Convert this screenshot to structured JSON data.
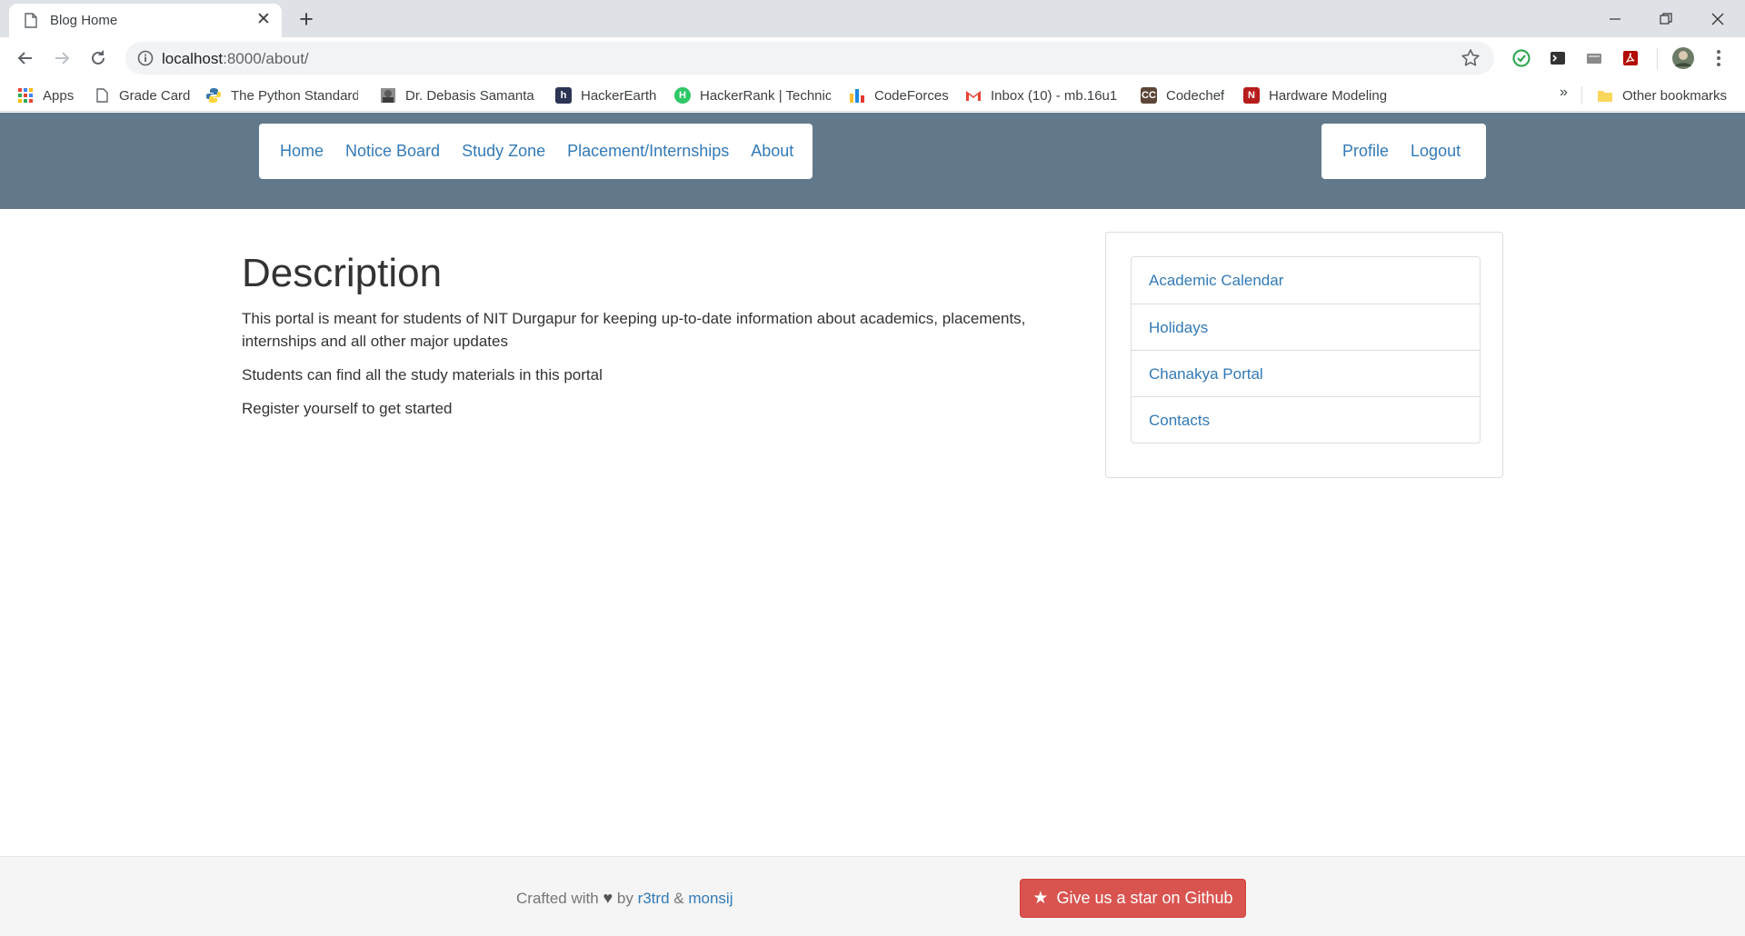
{
  "browser": {
    "tab_title": "Blog Home",
    "new_tab_symbol": "+",
    "close_symbol": "✕",
    "url_host": "localhost",
    "url_rest": ":8000/about/"
  },
  "bookmarks": {
    "apps": "Apps",
    "items": [
      {
        "label": "Grade Card",
        "icon": "page-icon"
      },
      {
        "label": "The Python Standard",
        "icon": "python-icon"
      },
      {
        "label": "Dr. Debasis Samanta,",
        "icon": "portrait-icon"
      },
      {
        "label": "HackerEarth",
        "icon": "hackerearth-icon"
      },
      {
        "label": "HackerRank | Technic",
        "icon": "hackerrank-icon"
      },
      {
        "label": "CodeForces",
        "icon": "codeforces-icon"
      },
      {
        "label": "Inbox (10) - mb.16u1",
        "icon": "gmail-icon"
      },
      {
        "label": "Codechef",
        "icon": "codechef-icon"
      },
      {
        "label": "Hardware Modeling",
        "icon": "nptel-icon"
      }
    ],
    "more": "»",
    "other": "Other bookmarks"
  },
  "site": {
    "nav_left": [
      "Home",
      "Notice Board",
      "Study Zone",
      "Placement/Internships",
      "About"
    ],
    "nav_right": [
      "Profile",
      "Logout"
    ],
    "heading": "Description",
    "paragraphs": [
      "This portal is meant for students of NIT Durgapur for keeping up-to-date information about academics, placements, internships and all other major updates",
      "Students can find all the study materials in this portal",
      "Register yourself to get started"
    ],
    "sidebar_links": [
      "Academic Calendar",
      "Holidays",
      "Chanakya Portal",
      "Contacts"
    ],
    "footer": {
      "crafted": "Crafted with",
      "heart": "♥",
      "by": "by",
      "author1": "r3trd",
      "amp": "&",
      "author2": "monsij",
      "button_star": "★",
      "button_label": "Give us a star on Github"
    }
  },
  "colors": {
    "header_bg": "#62788b",
    "link": "#337ab7",
    "danger": "#d9534f"
  }
}
